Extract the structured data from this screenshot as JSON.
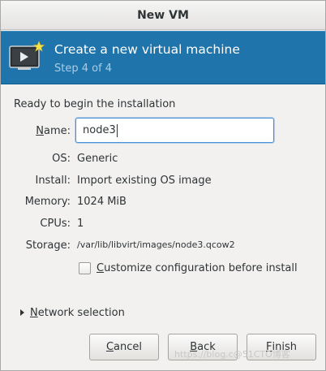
{
  "window": {
    "title": "New VM"
  },
  "banner": {
    "heading": "Create a new virtual machine",
    "step": "Step 4 of 4",
    "icon": "vm-screen-star-icon"
  },
  "summary": {
    "ready_text": "Ready to begin the installation",
    "name": {
      "label_mnemonic": "N",
      "label_rest": "ame:",
      "value": "node3"
    },
    "os": {
      "label": "OS:",
      "value": "Generic"
    },
    "install": {
      "label": "Install:",
      "value": "Import existing OS image"
    },
    "memory": {
      "label": "Memory:",
      "value": "1024 MiB"
    },
    "cpus": {
      "label": "CPUs:",
      "value": "1"
    },
    "storage": {
      "label": "Storage:",
      "value": "/var/lib/libvirt/images/node3.qcow2"
    }
  },
  "customize": {
    "checked": false,
    "label_mnemonic": "C",
    "label_rest": "ustomize configuration before install"
  },
  "network": {
    "expanded": false,
    "label_mnemonic": "N",
    "label_rest": "etwork selection"
  },
  "buttons": {
    "cancel": {
      "mnemonic": "C",
      "rest": "ancel"
    },
    "back": {
      "mnemonic": "B",
      "rest": "ack"
    },
    "finish": {
      "mnemonic": "F",
      "rest": "inish"
    }
  },
  "watermark": "https://blog.c@51CTO博客"
}
